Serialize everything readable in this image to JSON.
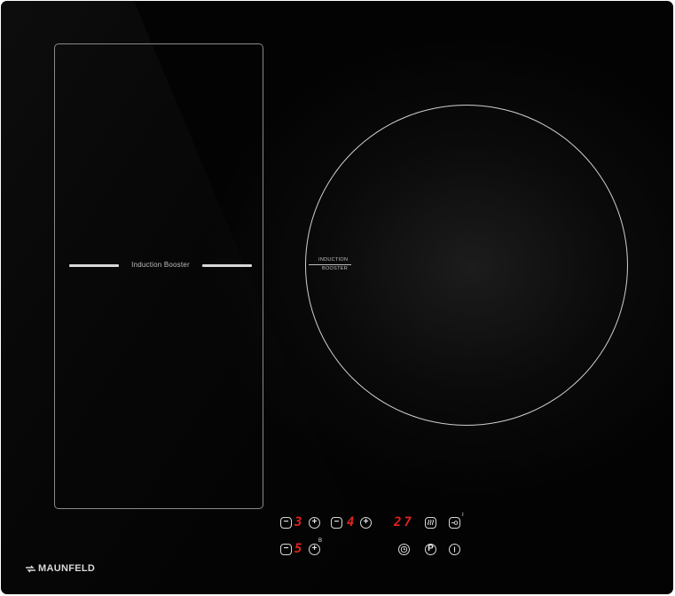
{
  "cooktop": {
    "brand": "MAUNFELD",
    "flex_zone": {
      "label": "Induction Booster"
    },
    "round_zone": {
      "label_line1": "INDUCTION",
      "label_line2": "BOOSTER"
    }
  },
  "controls": {
    "zone1_power": "3",
    "zone2_power": "4",
    "timer_display": "27",
    "zone3_power": "5",
    "minus_glyph": "−",
    "plus_glyph": "+",
    "pause_label": "P",
    "booster_mark": "B",
    "lock_mark": "I"
  },
  "colors": {
    "glass": "#050505",
    "display": "#e0231f",
    "markings": "#d0d0d0"
  },
  "icons": [
    "minus-icon",
    "plus-icon",
    "keep-warm-icon",
    "key-lock-icon",
    "clock-icon",
    "pause-icon",
    "power-icon"
  ]
}
